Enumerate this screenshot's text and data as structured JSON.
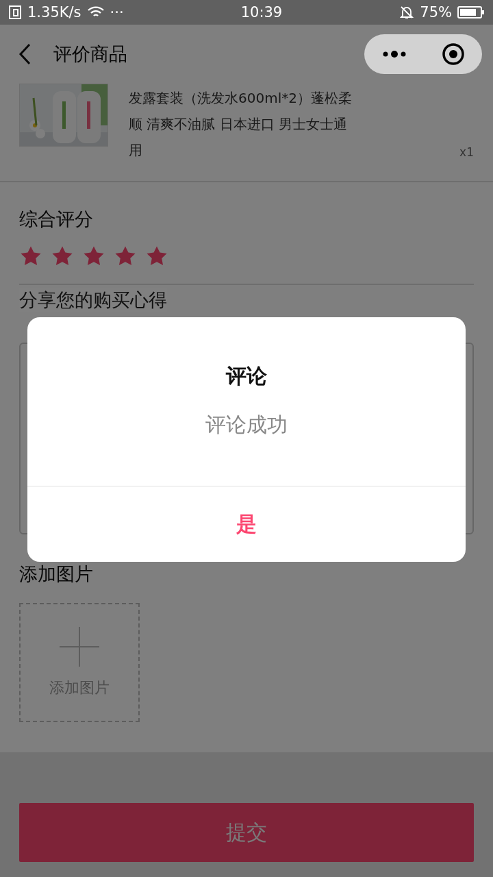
{
  "status_bar": {
    "network_speed": "1.35K/s",
    "dots": "···",
    "time": "10:39",
    "battery": "75%"
  },
  "nav": {
    "title": "评价商品"
  },
  "product": {
    "name": "发露套装（洗发水600ml*2）蓬松柔顺 清爽不油腻 日本进口 男士女士通用",
    "quantity": "x1"
  },
  "rating": {
    "label": "综合评分",
    "stars": 5
  },
  "review": {
    "label": "分享您的购买心得"
  },
  "photos": {
    "label": "添加图片",
    "upload_label": "添加图片"
  },
  "submit": {
    "label": "提交"
  },
  "dialog": {
    "title": "评论",
    "message": "评论成功",
    "confirm": "是"
  }
}
